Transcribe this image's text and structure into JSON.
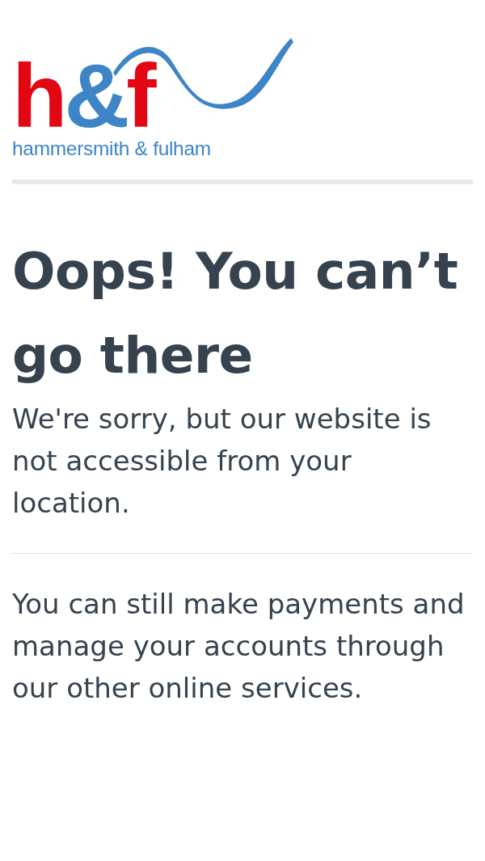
{
  "logo": {
    "mark": [
      {
        "text": "h",
        "color": "#e30613"
      },
      {
        "text": "&",
        "color": "#3d85c6"
      },
      {
        "text": "f",
        "color": "#e30613"
      }
    ],
    "name": "hammersmith & fulham"
  },
  "heading": "Oops! You can’t go there",
  "message": "We're sorry, but our website is not accessible from your location.",
  "note": "You can still make payments and manage your accounts through our other online services."
}
